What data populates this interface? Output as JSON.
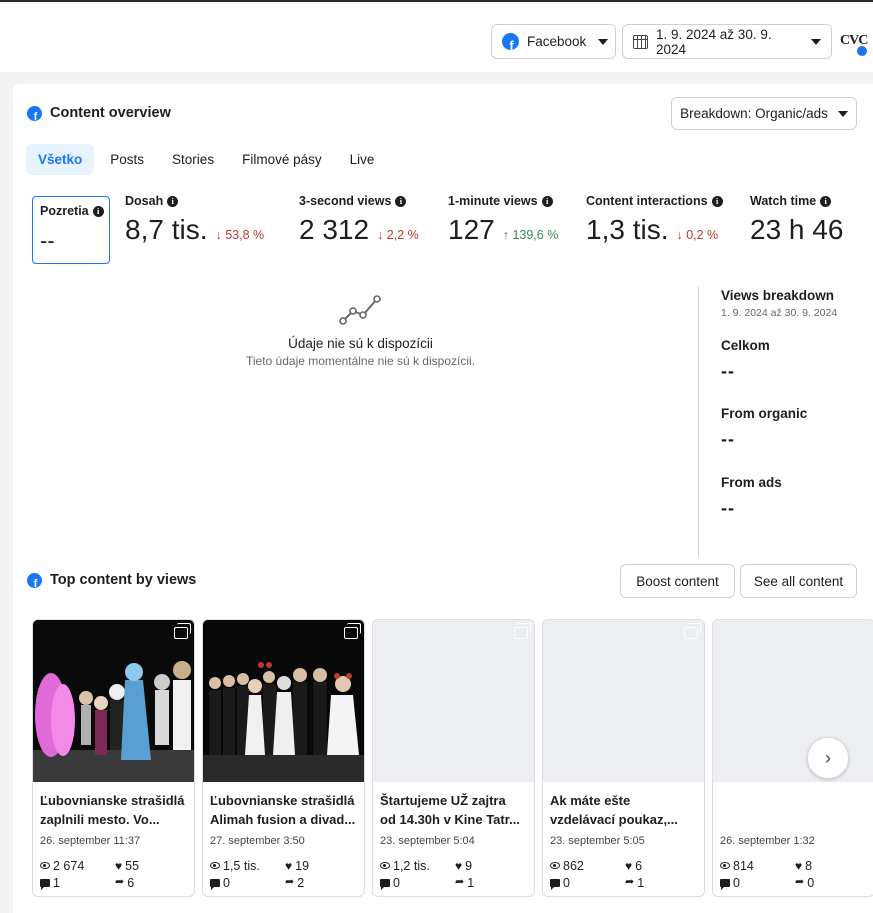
{
  "topbar": {
    "platform_label": "Facebook",
    "date_range": "1. 9. 2024 až 30. 9. 2024",
    "avatar_text": "CVC"
  },
  "content_overview": {
    "title": "Content overview",
    "breakdown_label": "Breakdown: Organic/ads",
    "tabs": [
      {
        "label": "Všetko",
        "active": true
      },
      {
        "label": "Posts",
        "active": false
      },
      {
        "label": "Stories",
        "active": false
      },
      {
        "label": "Filmové pásy",
        "active": false
      },
      {
        "label": "Live",
        "active": false
      }
    ],
    "metrics": [
      {
        "label": "Pozretia",
        "value": "--",
        "change": "",
        "direction": ""
      },
      {
        "label": "Dosah",
        "value": "8,7 tis.",
        "change": "↓ 53,8 %",
        "direction": "down"
      },
      {
        "label": "3-second views",
        "value": "2 312",
        "change": "↓ 2,2 %",
        "direction": "down"
      },
      {
        "label": "1-minute views",
        "value": "127",
        "change": "↑ 139,6 %",
        "direction": "up"
      },
      {
        "label": "Content interactions",
        "value": "1,3 tis.",
        "change": "↓ 0,2 %",
        "direction": "down"
      },
      {
        "label": "Watch time",
        "value": "23 h 46",
        "change": "",
        "direction": ""
      }
    ],
    "no_data": {
      "title": "Údaje nie sú k dispozícii",
      "subtitle": "Tieto údaje momentálne nie sú k dispozícii."
    },
    "views_breakdown": {
      "title": "Views breakdown",
      "range": "1. 9. 2024 až 30. 9. 2024",
      "rows": [
        {
          "label": "Celkom",
          "value": "--"
        },
        {
          "label": "From organic",
          "value": "--"
        },
        {
          "label": "From ads",
          "value": "--"
        }
      ]
    }
  },
  "top_content": {
    "title": "Top content by views",
    "boost_label": "Boost content",
    "see_all_label": "See all content",
    "posts": [
      {
        "title_line1": "Ľubovnianske strašidlá",
        "title_line2": "zaplnili mesto. Vo...",
        "date": "26. september 11:37",
        "views": "2 674",
        "likes": "55",
        "comments": "1",
        "shares": "6"
      },
      {
        "title_line1": "Ľubovnianske strašidlá",
        "title_line2": "Alimah fusion a divad...",
        "date": "27. september 3:50",
        "views": "1,5 tis.",
        "likes": "19",
        "comments": "0",
        "shares": "2"
      },
      {
        "title_line1": "Štartujeme UŽ zajtra",
        "title_line2": "od 14.30h v Kine Tatr...",
        "date": "23. september 5:04",
        "views": "1,2 tis.",
        "likes": "9",
        "comments": "0",
        "shares": "1"
      },
      {
        "title_line1": "Ak máte ešte",
        "title_line2": "vzdelávací poukaz,...",
        "date": "23. september 5:05",
        "views": "862",
        "likes": "6",
        "comments": "0",
        "shares": "1"
      },
      {
        "title_line1": "",
        "title_line2": "",
        "date": "26. september 1:32",
        "views": "814",
        "likes": "8",
        "comments": "0",
        "shares": "0"
      }
    ],
    "next_icon": "chevron-right-icon"
  },
  "colors": {
    "accent": "#1877f2",
    "down": "#c0392b",
    "up": "#2e8b57"
  }
}
